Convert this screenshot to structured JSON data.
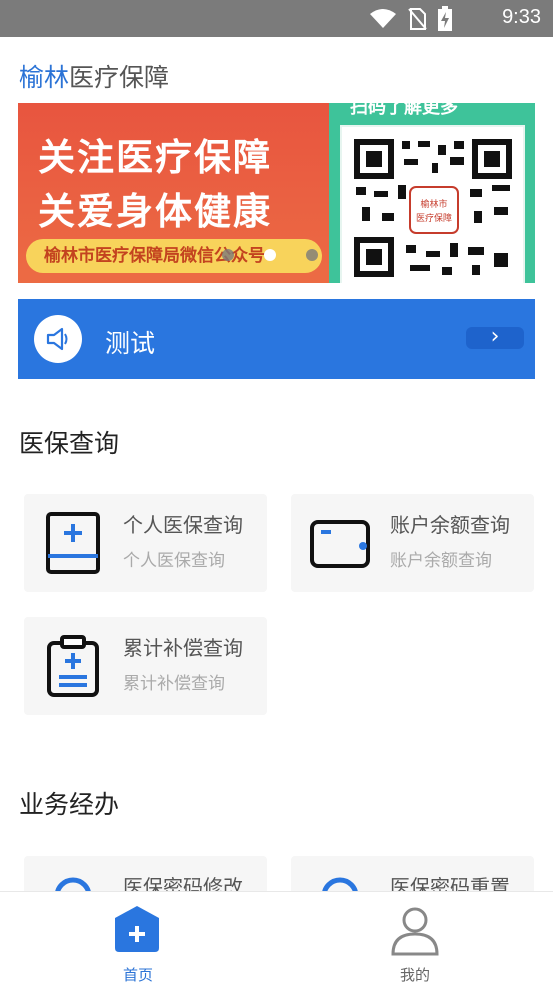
{
  "status": {
    "time": "9:33"
  },
  "header": {
    "city": "榆林",
    "rest": "医疗保障"
  },
  "banner": {
    "line1": "关注医疗保障",
    "line2": "关爱身体健康",
    "pill": "榆林市医疗保障局微信公众号",
    "qr_caption": "扫码了解更多",
    "qr_logo": "榆林市 医疗保障"
  },
  "notice": {
    "text": "测试"
  },
  "sections": {
    "query": "医保查询",
    "business": "业务经办"
  },
  "query_cards": [
    {
      "title": "个人医保查询",
      "subtitle": "个人医保查询",
      "icon": "medical-card-icon"
    },
    {
      "title": "账户余额查询",
      "subtitle": "账户余额查询",
      "icon": "wallet-icon"
    },
    {
      "title": "累计补偿查询",
      "subtitle": "累计补偿查询",
      "icon": "clipboard-plus-icon"
    }
  ],
  "business_cards": [
    {
      "title": "医保密码修改",
      "icon": "lock-icon"
    },
    {
      "title": "医保密码重置",
      "icon": "lock-icon"
    }
  ],
  "tabbar": {
    "home": "首页",
    "me": "我的"
  },
  "colors": {
    "brand_blue": "#2a76df",
    "banner_orange": "#ec6b44",
    "banner_green": "#3ec39a"
  }
}
